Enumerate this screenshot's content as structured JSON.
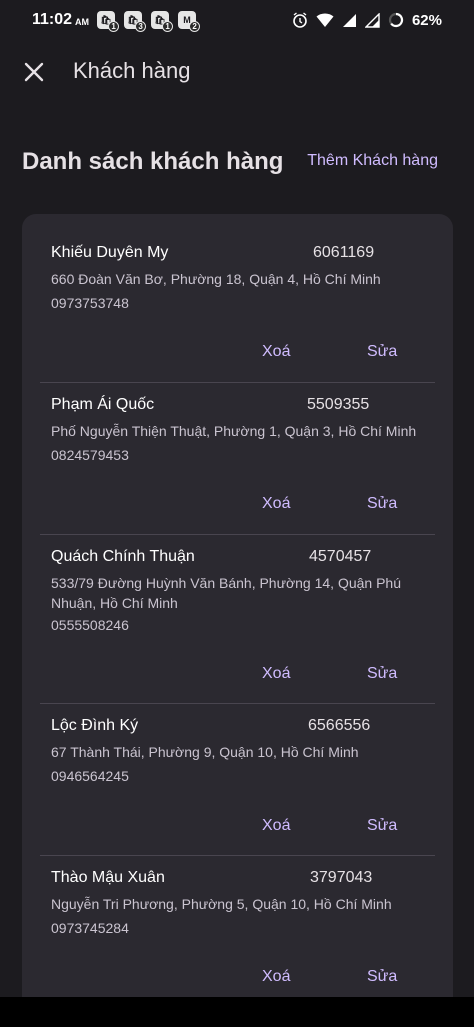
{
  "status_bar": {
    "time": "11:02",
    "ampm": "AM",
    "notifications": [
      {
        "icon": "shopping-bag-icon",
        "badge": "1"
      },
      {
        "icon": "shopping-bag-icon",
        "badge": "3"
      },
      {
        "icon": "shopping-bag-icon",
        "badge": "1"
      },
      {
        "icon": "app-notification-icon",
        "badge": "2"
      }
    ],
    "battery": "62%"
  },
  "header": {
    "title": "Khách hàng"
  },
  "list": {
    "title": "Danh sách khách hàng",
    "add_label": "Thêm Khách hàng"
  },
  "customers": [
    {
      "name": "Khiếu Duyên My",
      "code": "6061169",
      "address": "660 Đoàn Văn Bơ, Phường 18, Quận 4, Hồ Chí Minh",
      "phone": "0973753748",
      "delete_label": "Xoá",
      "edit_label": "Sửa"
    },
    {
      "name": "Phạm Ái Quốc",
      "code": "5509355",
      "address": "Phố Nguyễn Thiện Thuật, Phường 1, Quận 3, Hồ Chí Minh",
      "phone": "0824579453",
      "delete_label": "Xoá",
      "edit_label": "Sửa"
    },
    {
      "name": "Quách Chính Thuận",
      "code": "4570457",
      "address": "533/79 Đường Huỳnh Văn Bánh, Phường 14, Quận Phú Nhuận, Hồ Chí Minh",
      "phone": "0555508246",
      "delete_label": "Xoá",
      "edit_label": "Sửa"
    },
    {
      "name": "Lộc Đình Ký",
      "code": "6566556",
      "address": "67 Thành Thái, Phường 9, Quận 10, Hồ Chí Minh",
      "phone": "0946564245",
      "delete_label": "Xoá",
      "edit_label": "Sửa"
    },
    {
      "name": "Thào Mậu Xuân",
      "code": "3797043",
      "address": "Nguyễn Tri Phương, Phường 5, Quận 10, Hồ Chí Minh",
      "phone": "0973745284",
      "delete_label": "Xoá",
      "edit_label": "Sửa"
    }
  ],
  "colors": {
    "background": "#1c1b1f",
    "card": "#2b2930",
    "accent": "#d0bcff"
  }
}
